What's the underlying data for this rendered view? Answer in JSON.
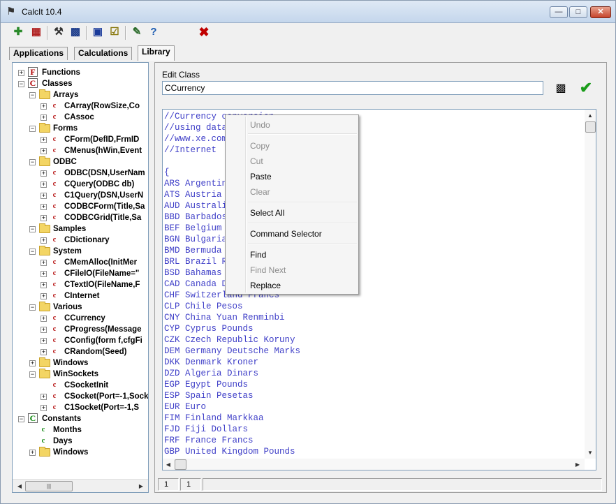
{
  "window": {
    "title": "CalcIt 10.4"
  },
  "tabs": [
    {
      "label": "Applications"
    },
    {
      "label": "Calculations"
    },
    {
      "label": "Library"
    }
  ],
  "tree": [
    {
      "label": "Functions",
      "level": 0,
      "icon": "F",
      "expand": "+"
    },
    {
      "label": "Classes",
      "level": 0,
      "icon": "C",
      "expand": "-"
    },
    {
      "label": "Arrays",
      "level": 1,
      "icon": "folder",
      "expand": "-"
    },
    {
      "label": "CArray(RowSize,Co",
      "level": 2,
      "icon": "c",
      "expand": "+"
    },
    {
      "label": "CAssoc",
      "level": 2,
      "icon": "c",
      "expand": "+"
    },
    {
      "label": "Forms",
      "level": 1,
      "icon": "folder",
      "expand": "-"
    },
    {
      "label": "CForm(DefID,FrmID",
      "level": 2,
      "icon": "c",
      "expand": "+"
    },
    {
      "label": "CMenus(hWin,Event",
      "level": 2,
      "icon": "c",
      "expand": "+"
    },
    {
      "label": "ODBC",
      "level": 1,
      "icon": "folder",
      "expand": "-"
    },
    {
      "label": "ODBC(DSN,UserNam",
      "level": 2,
      "icon": "c",
      "expand": "+"
    },
    {
      "label": "CQuery(ODBC db)",
      "level": 2,
      "icon": "c",
      "expand": "+"
    },
    {
      "label": "C1Query(DSN,UserN",
      "level": 2,
      "icon": "c",
      "expand": "+"
    },
    {
      "label": "CODBCForm(Title,Sa",
      "level": 2,
      "icon": "c",
      "expand": "+"
    },
    {
      "label": "CODBCGrid(Title,Sa",
      "level": 2,
      "icon": "c",
      "expand": "+"
    },
    {
      "label": "Samples",
      "level": 1,
      "icon": "folder",
      "expand": "-"
    },
    {
      "label": "CDictionary",
      "level": 2,
      "icon": "c",
      "expand": "+"
    },
    {
      "label": "System",
      "level": 1,
      "icon": "folder",
      "expand": "-"
    },
    {
      "label": "CMemAlloc(InitMer",
      "level": 2,
      "icon": "c",
      "expand": "+"
    },
    {
      "label": "CFileIO(FileName=\"",
      "level": 2,
      "icon": "c",
      "expand": "+"
    },
    {
      "label": "CTextIO(FileName,F",
      "level": 2,
      "icon": "c",
      "expand": "+"
    },
    {
      "label": "CInternet",
      "level": 2,
      "icon": "c",
      "expand": "+"
    },
    {
      "label": "Various",
      "level": 1,
      "icon": "folder",
      "expand": "-"
    },
    {
      "label": "CCurrency",
      "level": 2,
      "icon": "c",
      "expand": "+"
    },
    {
      "label": "CProgress(Message",
      "level": 2,
      "icon": "c",
      "expand": "+"
    },
    {
      "label": "CConfig(form f,cfgFi",
      "level": 2,
      "icon": "c",
      "expand": "+"
    },
    {
      "label": "CRandom(Seed)",
      "level": 2,
      "icon": "c",
      "expand": "+"
    },
    {
      "label": "Windows",
      "level": 1,
      "icon": "folder",
      "expand": "+"
    },
    {
      "label": "WinSockets",
      "level": 1,
      "icon": "folder",
      "expand": "-"
    },
    {
      "label": "CSocketInit",
      "level": 2,
      "icon": "c",
      "expand": ""
    },
    {
      "label": "CSocket(Port=-1,Sock",
      "level": 2,
      "icon": "c",
      "expand": "+"
    },
    {
      "label": "C1Socket(Port=-1,S",
      "level": 2,
      "icon": "c",
      "expand": "+"
    },
    {
      "label": "Constants",
      "level": 0,
      "icon": "Cg",
      "expand": "-"
    },
    {
      "label": "Months",
      "level": 1,
      "icon": "cg",
      "expand": ""
    },
    {
      "label": "Days",
      "level": 1,
      "icon": "cg",
      "expand": ""
    },
    {
      "label": "Windows",
      "level": 1,
      "icon": "folder",
      "expand": "+"
    }
  ],
  "editor": {
    "edit_class_label": "Edit Class",
    "class_value": "CCurrency",
    "code": "//Currency conversion\n//using data from\n//www.xe.com\n//Internet\n\n{\nARS Argentina Pesos\nATS Austria Schillings\nAUD Australia Dollars\nBBD Barbados Dollars\nBEF Belgium Francs\nBGN Bulgaria Leva\nBMD Bermuda Dollars\nBRL Brazil Reais\nBSD Bahamas Dollars\nCAD Canada Dollars\nCHF Switzerland Francs\nCLP Chile Pesos\nCNY China Yuan Renminbi\nCYP Cyprus Pounds\nCZK Czech Republic Koruny\nDEM Germany Deutsche Marks\nDKK Denmark Kroner\nDZD Algeria Dinars\nEGP Egypt Pounds\nESP Spain Pesetas\nEUR Euro\nFIM Finland Markkaa\nFJD Fiji Dollars\nFRF France Francs\nGBP United Kingdom Pounds"
  },
  "status": {
    "line": "1",
    "col": "1"
  },
  "context_menu": {
    "items": [
      {
        "label": "Undo",
        "disabled": true
      },
      {
        "label": "Copy",
        "disabled": true
      },
      {
        "label": "Cut",
        "disabled": true
      },
      {
        "label": "Paste",
        "disabled": false
      },
      {
        "label": "Clear",
        "disabled": true
      },
      {
        "label": "Select All",
        "disabled": false
      },
      {
        "label": "Command Selector",
        "disabled": false
      },
      {
        "label": "Find",
        "disabled": false
      },
      {
        "label": "Find Next",
        "disabled": true
      },
      {
        "label": "Replace",
        "disabled": false
      }
    ]
  },
  "toolbar_icons": [
    "new-icon",
    "table-icon",
    "tools-icon",
    "calculator-icon",
    "save-icon",
    "checklist-icon",
    "options-icon",
    "help-icon",
    "delete-icon"
  ],
  "colors": {
    "code_text": "#4040c8",
    "delete": "#c00000",
    "ok": "#1a9c1a",
    "class_icon": "#b00000",
    "constant_icon": "#008000"
  }
}
